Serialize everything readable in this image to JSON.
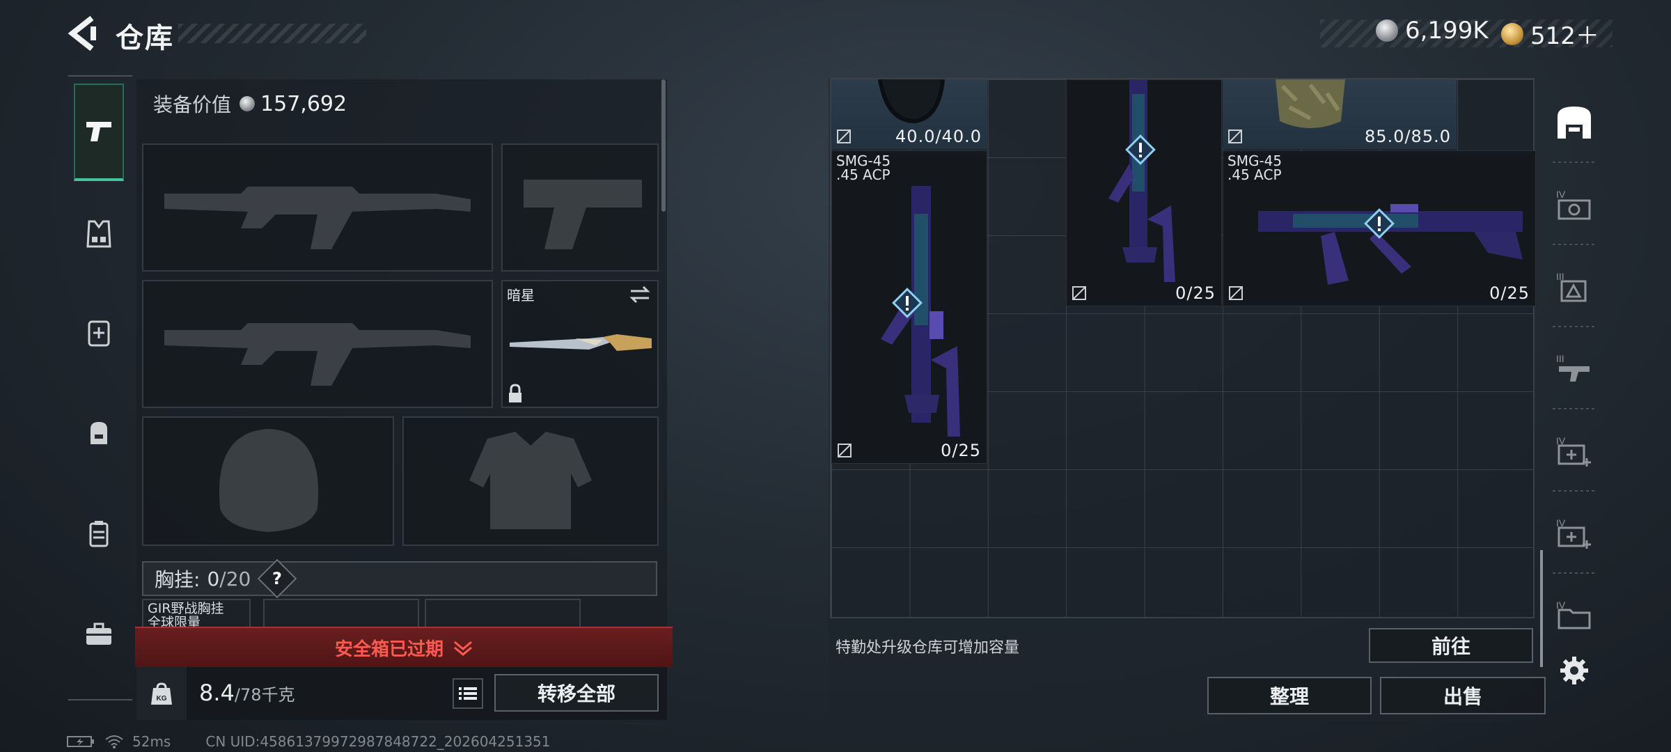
{
  "header": {
    "title": "仓库",
    "currency_silver": "6,199K",
    "currency_gold": "512＋"
  },
  "loadout": {
    "equipment_value_label": "装备价值",
    "equipment_value": "157,692",
    "melee_name": "暗星",
    "chest_rig_label": "胸挂:",
    "chest_rig_used": "0",
    "chest_rig_capacity": "/20",
    "chest_rig_help": "?",
    "chest_rig_item_name": "GIR野战胸挂",
    "chest_rig_item_sub": "全球限量",
    "safe_box_status": "安全箱已过期",
    "weight_current": "8.4",
    "weight_max": "/78千克",
    "weight_icon_text": "KG",
    "transfer_all": "转移全部"
  },
  "storage": {
    "items": [
      {
        "type": "gear",
        "durability": "40.0/40.0"
      },
      {
        "type": "gun",
        "count": "0/25"
      },
      {
        "type": "gear",
        "durability": "85.0/85.0"
      },
      {
        "type": "gun",
        "name": "SMG-45",
        "ammo": ".45 ACP",
        "count": "0/25"
      },
      {
        "type": "gun",
        "name": "SMG-45",
        "ammo": ".45 ACP",
        "count": "0/25"
      }
    ],
    "upgrade_hint": "特勤处升级仓库可增加容量",
    "goto_button": "前往",
    "sort_button": "整理",
    "sell_button": "出售"
  },
  "rail": {
    "tiers": [
      "IV",
      "III",
      "III",
      "IV",
      "IV",
      "IV"
    ]
  },
  "status": {
    "ping": "52ms",
    "uid": "CN UID:45861379972987848722_202604251351"
  },
  "colors": {
    "accent_green": "#46c49a",
    "danger_red": "#ff5a52",
    "warn_blue": "#8fd0f0"
  }
}
